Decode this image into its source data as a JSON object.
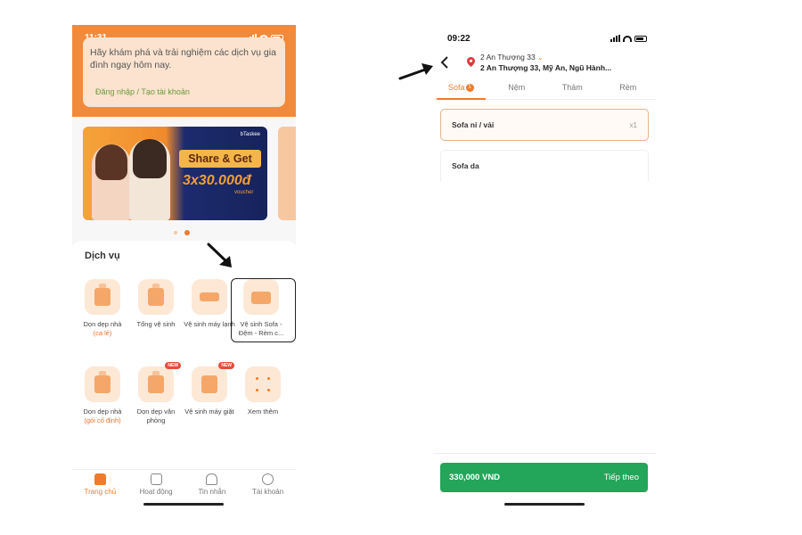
{
  "left": {
    "status": {
      "time": "11:31"
    },
    "login": {
      "text": "Hãy khám phá và trải nghiệm các dịch vụ gia đình ngay hôm nay.",
      "link": "Đăng nhập / Tạo tài khoản"
    },
    "banner": {
      "headline": "Share & Get",
      "amount": "3x30.000đ",
      "voucher": "voucher",
      "brand": "bTaskee"
    },
    "services_title": "Dịch vụ",
    "services": [
      {
        "label": "Dọn dẹp nhà",
        "sub": "(ca lẻ)",
        "icon": "broom-icon"
      },
      {
        "label": "Tổng vệ sinh",
        "icon": "house-icon"
      },
      {
        "label": "Vệ sinh máy lạnh",
        "icon": "air-conditioner-icon"
      },
      {
        "label": "Vệ sinh Sofa - Đệm - Rèm c...",
        "icon": "sofa-icon"
      },
      {
        "label": "Dọn dẹp nhà",
        "sub": "(gói cố định)",
        "icon": "vacuum-icon"
      },
      {
        "label": "Dọn dẹp văn phòng",
        "badge": "NEW",
        "icon": "office-icon"
      },
      {
        "label": "Vệ sinh máy giặt",
        "badge": "NEW",
        "icon": "washing-machine-icon"
      },
      {
        "label": "Xem thêm",
        "icon": "more-icon"
      }
    ],
    "nav": [
      {
        "label": "Trang chủ",
        "icon": "home-icon",
        "active": true
      },
      {
        "label": "Hoạt động",
        "icon": "activity-icon"
      },
      {
        "label": "Tin nhắn",
        "icon": "bell-icon"
      },
      {
        "label": "Tài khoản",
        "icon": "user-icon"
      }
    ]
  },
  "right": {
    "status": {
      "time": "09:22"
    },
    "address_short": "2 An Thượng 33",
    "address_full": "2 An Thượng 33, Mỹ An, Ngũ Hành...",
    "tabs": [
      {
        "label": "Sofa",
        "badge": "1",
        "active": true
      },
      {
        "label": "Nệm"
      },
      {
        "label": "Thảm"
      },
      {
        "label": "Rèm"
      }
    ],
    "items": [
      {
        "name": "Sofa nỉ / vải",
        "qty": "x1",
        "selected": true
      },
      {
        "name": "Sofa da"
      }
    ],
    "checkout": {
      "price": "330,000 VND",
      "action": "Tiếp theo"
    }
  },
  "colors": {
    "accent": "#f07b2a",
    "primary_button": "#23a55a"
  }
}
